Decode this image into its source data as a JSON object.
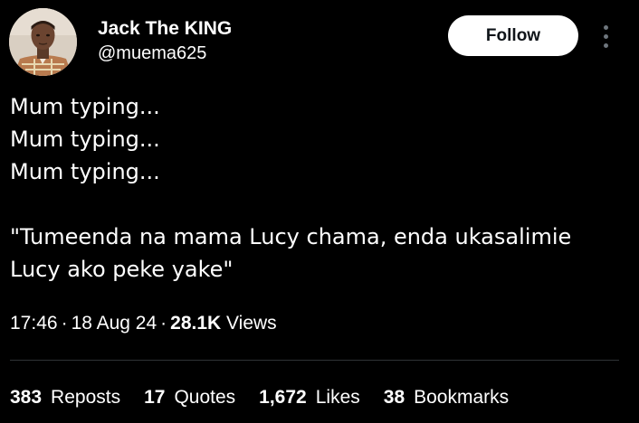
{
  "author": {
    "display_name": "Jack The KING",
    "handle": "@muema625"
  },
  "follow_label": "Follow",
  "tweet": {
    "lines": [
      "Mum typing...",
      "Mum typing...",
      "Mum typing...",
      "",
      "\"Tumeenda na mama Lucy chama, enda ukasalimie",
      "Lucy ako peke yake\""
    ]
  },
  "meta": {
    "time": "17:46",
    "separator": "·",
    "date": "18 Aug 24",
    "views_count": "28.1K",
    "views_label": "Views"
  },
  "stats": {
    "reposts_count": "383",
    "reposts_label": "Reposts",
    "quotes_count": "17",
    "quotes_label": "Quotes",
    "likes_count": "1,672",
    "likes_label": "Likes",
    "bookmarks_count": "38",
    "bookmarks_label": "Bookmarks"
  },
  "icons": {
    "more": "more-vertical-icon"
  },
  "colors": {
    "background": "#000000",
    "text": "#ffffff",
    "muted": "#6e767d",
    "divider": "#2f3336",
    "button_bg": "#ffffff",
    "button_text": "#0f1419"
  }
}
